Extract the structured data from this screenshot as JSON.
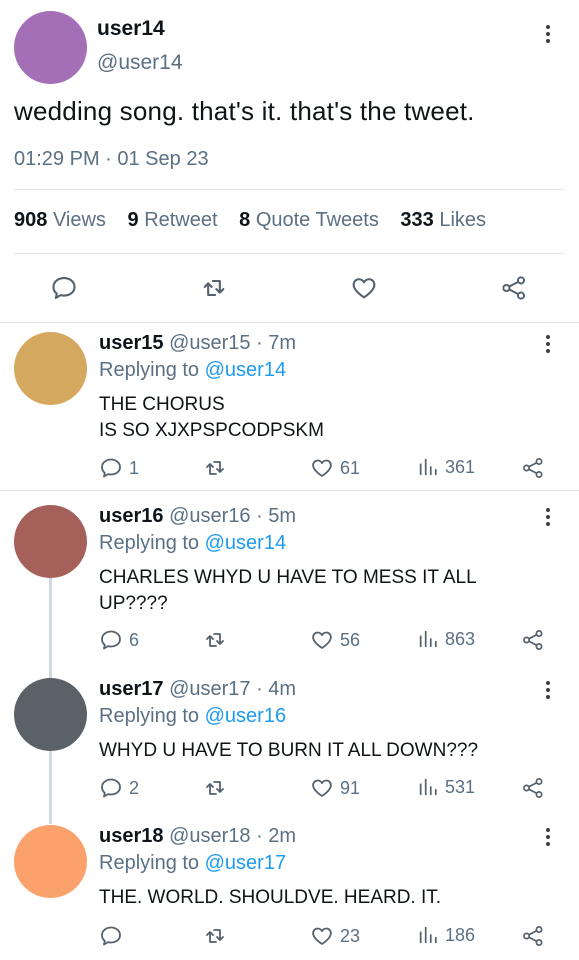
{
  "main_tweet": {
    "avatar_color": "#a56fb8",
    "name": "user14",
    "handle": "@user14",
    "text": "wedding song. that's it. that's the tweet.",
    "timestamp": "01:29 PM · 01 Sep 23",
    "stats": {
      "views_count": "908",
      "views_label": "Views",
      "retweets_count": "9",
      "retweets_label": "Retweet",
      "quotes_count": "8",
      "quotes_label": "Quote Tweets",
      "likes_count": "333",
      "likes_label": "Likes"
    },
    "actions": [
      "reply-icon",
      "retweet-icon",
      "like-icon",
      "share-icon"
    ]
  },
  "replies": [
    {
      "avatar_color": "#d4a85e",
      "name": "user15",
      "handle": "@user15",
      "time": "· 7m",
      "replying_prefix": "Replying to",
      "replying_to": "@user14",
      "text_lines": [
        "THE CHORUS",
        "IS SO XJXPSPCODPSKM"
      ],
      "replies": "1",
      "likes": "61",
      "views": "361"
    },
    {
      "avatar_color": "#a5605a",
      "name": "user16",
      "handle": "@user16",
      "time": "· 5m",
      "replying_prefix": "Replying to",
      "replying_to": "@user14",
      "text_lines": [
        "CHARLES WHYD U HAVE TO MESS IT ALL",
        "UP????"
      ],
      "replies": "6",
      "likes": "56",
      "views": "863"
    },
    {
      "avatar_color": "#5a6268",
      "name": "user17",
      "handle": "@user17",
      "time": "· 4m",
      "replying_prefix": "Replying to",
      "replying_to": "@user16",
      "text_lines": [
        "WHYD U HAVE TO BURN IT ALL DOWN???"
      ],
      "replies": "2",
      "likes": "91",
      "views": "531"
    },
    {
      "avatar_color": "#fba16c",
      "name": "user18",
      "handle": "@user18",
      "time": "· 2m",
      "replying_prefix": "Replying to",
      "replying_to": "@user17",
      "text_lines": [
        "THE. WORLD. SHOULDVE. HEARD. IT."
      ],
      "replies": "",
      "likes": "23",
      "views": "186"
    }
  ],
  "colors": {
    "accent": "#1d9bf0",
    "muted": "#5b7083"
  }
}
